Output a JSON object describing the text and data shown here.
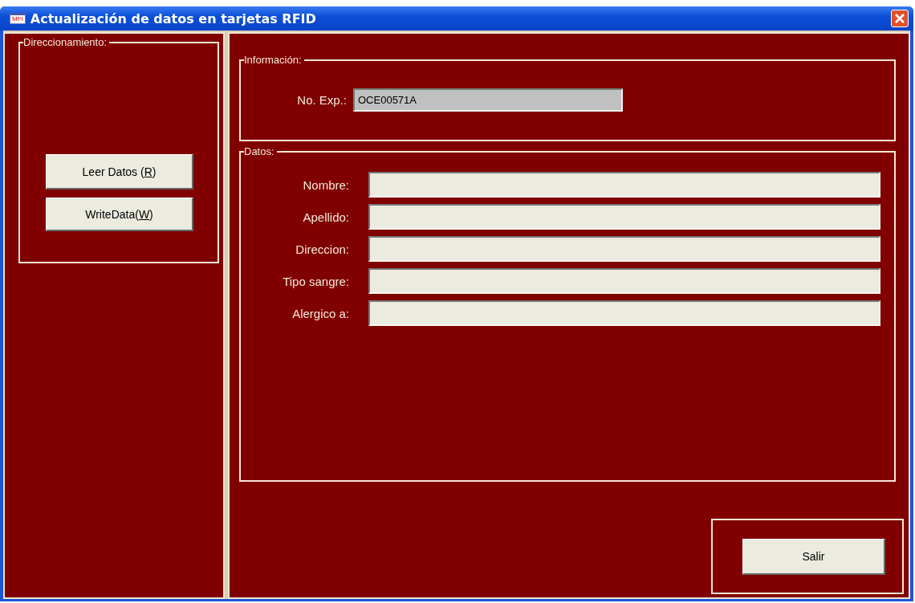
{
  "window": {
    "title": "Actualización de datos en tarjetas RFID",
    "icon_text": "MFI"
  },
  "addressing": {
    "title": "Direccionamiento:",
    "buttons": [
      {
        "before": "Leer Datos (",
        "key": "R",
        "after": ")"
      },
      {
        "before": "WriteData(",
        "key": "W",
        "after": ")"
      }
    ]
  },
  "information": {
    "title": "Información:",
    "label": "No. Exp.:",
    "value": "OCE00571A"
  },
  "data": {
    "title": "Datos:",
    "fields": [
      {
        "label": "Nombre:"
      },
      {
        "label": "Apellido:"
      },
      {
        "label": "Direccion:"
      },
      {
        "label": "Tipo sangre:"
      },
      {
        "label": "Alergico a:"
      }
    ]
  },
  "exit_button": "Salir"
}
